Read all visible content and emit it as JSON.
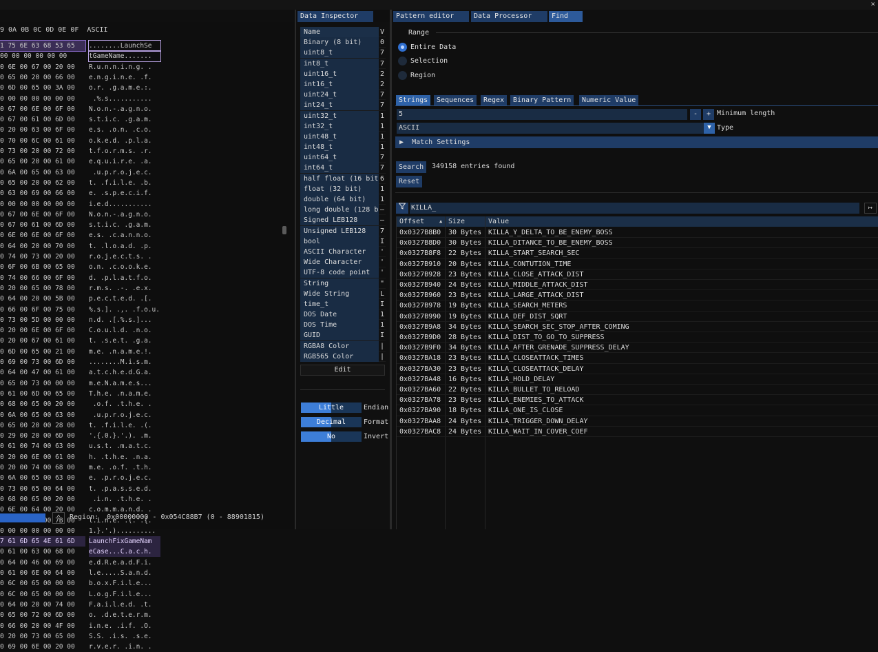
{
  "close_label": "×",
  "tabs": {
    "data_inspector": "Data Inspector",
    "pattern_editor": "Pattern editor",
    "data_processor": "Data Processor",
    "find": "Find"
  },
  "hex": {
    "header": "9 0A 0B 0C 0D 0E 0F  ASCII",
    "rows": [
      {
        "hex": "1 75 6E 63 68 53 65",
        "ascii": "........LaunchSe",
        "hex_sel": true,
        "ascii_box": true
      },
      {
        "hex": "00 00 00 00 00 00",
        "ascii": "tGameName.......",
        "ascii_box": true
      },
      {
        "hex": "0 6E 00 67 00 20 00",
        "ascii": "R.u.n.n.i.n.g. ."
      },
      {
        "hex": "0 65 00 20 00 66 00",
        "ascii": "e.n.g.i.n.e. .f."
      },
      {
        "hex": "0 6D 00 65 00 3A 00",
        "ascii": "o.r. .g.a.m.e.:."
      },
      {
        "hex": "0 00 00 00 00 00 00",
        "ascii": " .%.s..........."
      },
      {
        "hex": "0 67 00 6E 00 6F 00",
        "ascii": "N.o.n.-.a.g.n.o."
      },
      {
        "hex": "0 67 00 61 00 6D 00",
        "ascii": "s.t.i.c. .g.a.m."
      },
      {
        "hex": "0 20 00 63 00 6F 00",
        "ascii": "e.s. .o.n. .c.o."
      },
      {
        "hex": "0 70 00 6C 00 61 00",
        "ascii": "o.k.e.d. .p.l.a."
      },
      {
        "hex": "0 73 00 20 00 72 00",
        "ascii": "t.f.o.r.m.s. .r."
      },
      {
        "hex": "0 65 00 20 00 61 00",
        "ascii": "e.q.u.i.r.e. .a."
      },
      {
        "hex": "0 6A 00 65 00 63 00",
        "ascii": " .u.p.r.o.j.e.c."
      },
      {
        "hex": "0 65 00 20 00 62 00",
        "ascii": "t. .f.i.l.e. .b."
      },
      {
        "hex": "0 63 00 69 00 66 00",
        "ascii": "e. .s.p.e.c.i.f."
      },
      {
        "hex": "0 00 00 00 00 00 00",
        "ascii": "i.e.d..........."
      },
      {
        "hex": "0 67 00 6E 00 6F 00",
        "ascii": "N.o.n.-.a.g.n.o."
      },
      {
        "hex": "0 67 00 61 00 6D 00",
        "ascii": "s.t.i.c. .g.a.m."
      },
      {
        "hex": "0 6E 00 6E 00 6F 00",
        "ascii": "e.s. .c.a.n.n.o."
      },
      {
        "hex": "0 64 00 20 00 70 00",
        "ascii": "t. .l.o.a.d. .p."
      },
      {
        "hex": "0 74 00 73 00 20 00",
        "ascii": "r.o.j.e.c.t.s. ."
      },
      {
        "hex": "0 6F 00 6B 00 65 00",
        "ascii": "o.n. .c.o.o.k.e."
      },
      {
        "hex": "0 74 00 66 00 6F 00",
        "ascii": "d. .p.l.a.t.f.o."
      },
      {
        "hex": "0 20 00 65 00 78 00",
        "ascii": "r.m.s. .-. .e.x."
      },
      {
        "hex": "0 64 00 20 00 5B 00",
        "ascii": "p.e.c.t.e.d. .[."
      },
      {
        "hex": "0 66 00 6F 00 75 00",
        "ascii": "%.s.]. .,. .f.o.u."
      },
      {
        "hex": "0 73 00 5D 00 00 00",
        "ascii": "n.d. .[.%.s.]..."
      },
      {
        "hex": "0 20 00 6E 00 6F 00",
        "ascii": "C.o.u.l.d. .n.o."
      },
      {
        "hex": "0 20 00 67 00 61 00",
        "ascii": "t. .s.e.t. .g.a."
      },
      {
        "hex": "0 6D 00 65 00 21 00",
        "ascii": "m.e. .n.a.m.e.!."
      },
      {
        "hex": "0 69 00 73 00 6D 00",
        "ascii": "........M.i.s.m."
      },
      {
        "hex": "0 64 00 47 00 61 00",
        "ascii": "a.t.c.h.e.d.G.a."
      },
      {
        "hex": "0 65 00 73 00 00 00",
        "ascii": "m.e.N.a.m.e.s..."
      },
      {
        "hex": "0 61 00 6D 00 65 00",
        "ascii": "T.h.e. .n.a.m.e."
      },
      {
        "hex": "0 68 00 65 00 20 00",
        "ascii": " .o.f. .t.h.e. ."
      },
      {
        "hex": "0 6A 00 65 00 63 00",
        "ascii": " .u.p.r.o.j.e.c."
      },
      {
        "hex": "0 65 00 20 00 28 00",
        "ascii": "t. .f.i.l.e. .(."
      },
      {
        "hex": "0 29 00 20 00 6D 00",
        "ascii": "'.{.0.}.'.). .m."
      },
      {
        "hex": "0 61 00 74 00 63 00",
        "ascii": "u.s.t. .m.a.t.c."
      },
      {
        "hex": "0 20 00 6E 00 61 00",
        "ascii": "h. .t.h.e. .n.a."
      },
      {
        "hex": "0 20 00 74 00 68 00",
        "ascii": "m.e. .o.f. .t.h."
      },
      {
        "hex": "0 6A 00 65 00 63 00",
        "ascii": "e. .p.r.o.j.e.c."
      },
      {
        "hex": "0 73 00 65 00 64 00",
        "ascii": "t. .p.a.s.s.e.d."
      },
      {
        "hex": "0 68 00 65 00 20 00",
        "ascii": " .i.n. .t.h.e. ."
      },
      {
        "hex": "0 6E 00 64 00 20 00",
        "ascii": "c.o.m.m.a.n.d. ."
      },
      {
        "hex": "0 28 00 27 00 7B 00",
        "ascii": "l.i.n.e. .(.'.{."
      },
      {
        "hex": "0 00 00 00 00 00 00",
        "ascii": "1.}.'.).........."
      },
      {
        "hex": "7 61 6D 65 4E 61 6D",
        "ascii": "LaunchFixGameNam",
        "purple": true
      },
      {
        "hex": "0 61 00 63 00 68 00",
        "ascii": "eCase...C.a.c.h.",
        "ascii_purple": true
      },
      {
        "hex": "0 64 00 46 00 69 00",
        "ascii": "e.d.R.e.a.d.F.i."
      },
      {
        "hex": "0 61 00 6E 00 64 00",
        "ascii": "l.e.....S.a.n.d."
      },
      {
        "hex": "0 6C 00 65 00 00 00",
        "ascii": "b.o.x.F.i.l.e..."
      },
      {
        "hex": "0 6C 00 65 00 00 00",
        "ascii": "L.o.g.F.i.l.e..."
      },
      {
        "hex": "0 64 00 20 00 74 00",
        "ascii": "F.a.i.l.e.d. .t."
      },
      {
        "hex": "0 65 00 72 00 6D 00",
        "ascii": "o. .d.e.t.e.r.m."
      },
      {
        "hex": "0 66 00 20 00 4F 00",
        "ascii": "i.n.e. .i.f. .O."
      },
      {
        "hex": "0 20 00 73 00 65 00",
        "ascii": "S.S. .i.s. .s.e."
      },
      {
        "hex": "0 69 00 6E 00 20 00",
        "ascii": "r.v.e.r. .i.n. ."
      }
    ],
    "region_label": "Region:  0x00000000 - 0x054C88B7 (0 - 88901815)",
    "up_icon": "⌃"
  },
  "inspector": {
    "col_name": "Name",
    "col_value": "V",
    "rows": [
      {
        "name": "Binary (8 bit)",
        "value": "0"
      },
      {
        "name": "uint8_t",
        "value": "7"
      },
      {
        "name": "int8_t",
        "value": "7"
      },
      {
        "name": "uint16_t",
        "value": "2"
      },
      {
        "name": "int16_t",
        "value": "2"
      },
      {
        "name": "uint24_t",
        "value": "7"
      },
      {
        "name": "int24_t",
        "value": "7"
      },
      {
        "name": "uint32_t",
        "value": "1"
      },
      {
        "name": "int32_t",
        "value": "1"
      },
      {
        "name": "uint48_t",
        "value": "1"
      },
      {
        "name": "int48_t",
        "value": "1"
      },
      {
        "name": "uint64_t",
        "value": "7"
      },
      {
        "name": "int64_t",
        "value": "7"
      },
      {
        "name": "half float (16 bit)",
        "value": "6"
      },
      {
        "name": "float (32 bit)",
        "value": "1"
      },
      {
        "name": "double (64 bit)",
        "value": "1"
      },
      {
        "name": "long double (128 bit)",
        "value": "–"
      },
      {
        "name": "Signed LEB128",
        "value": "–"
      },
      {
        "name": "Unsigned LEB128",
        "value": "7"
      },
      {
        "name": "bool",
        "value": "I"
      },
      {
        "name": "ASCII Character",
        "value": "'"
      },
      {
        "name": "Wide Character",
        "value": "'"
      },
      {
        "name": "UTF-8 code point",
        "value": "'"
      },
      {
        "name": "String",
        "value": "\""
      },
      {
        "name": "Wide String",
        "value": "L"
      },
      {
        "name": "time_t",
        "value": "I"
      },
      {
        "name": "DOS Date",
        "value": "1"
      },
      {
        "name": "DOS Time",
        "value": "1"
      },
      {
        "name": "GUID",
        "value": "I"
      },
      {
        "name": "RGBA8 Color",
        "value": "|"
      },
      {
        "name": "RGB565 Color",
        "value": "|"
      }
    ],
    "edit_label": "Edit",
    "options": [
      {
        "value": "Little",
        "label": "Endian",
        "fill": 0.5
      },
      {
        "value": "Decimal",
        "label": "Format",
        "fill": 0.5
      },
      {
        "value": "No",
        "label": "Invert",
        "fill": 0.5
      }
    ]
  },
  "find": {
    "range_label": "Range",
    "range_options": [
      "Entire Data",
      "Selection",
      "Region"
    ],
    "range_selected": 0,
    "subtabs": [
      "Strings",
      "Sequences",
      "Regex",
      "Binary Pattern",
      "Numeric Value"
    ],
    "subtab_selected": 0,
    "min_length_value": "5",
    "minus": "-",
    "plus": "+",
    "min_length_label": "Minimum length",
    "type_value": "ASCII",
    "type_label": "Type",
    "match_settings_label": "Match Settings",
    "search_label": "Search",
    "entries_found": "349158 entries found",
    "reset_label": "Reset",
    "filter_icon": "filter-icon",
    "filter_value": "KILLA_",
    "filter_end_icon": "↦",
    "columns": {
      "offset": "Offset",
      "sort": "▲",
      "size": "Size",
      "value": "Value"
    },
    "results": [
      {
        "offset": "0x0327B8B0",
        "size": "30 Bytes",
        "value": "KILLA_Y_DELTA_TO_BE_ENEMY_BOSS"
      },
      {
        "offset": "0x0327B8D0",
        "size": "30 Bytes",
        "value": "KILLA_DITANCE_TO_BE_ENEMY_BOSS"
      },
      {
        "offset": "0x0327B8F8",
        "size": "22 Bytes",
        "value": "KILLA_START_SEARCH_SEC"
      },
      {
        "offset": "0x0327B910",
        "size": "20 Bytes",
        "value": "KILLA_CONTUTION_TIME"
      },
      {
        "offset": "0x0327B928",
        "size": "23 Bytes",
        "value": "KILLA_CLOSE_ATTACK_DIST"
      },
      {
        "offset": "0x0327B940",
        "size": "24 Bytes",
        "value": "KILLA_MIDDLE_ATTACK_DIST"
      },
      {
        "offset": "0x0327B960",
        "size": "23 Bytes",
        "value": "KILLA_LARGE_ATTACK_DIST"
      },
      {
        "offset": "0x0327B978",
        "size": "19 Bytes",
        "value": "KILLA_SEARCH_METERS"
      },
      {
        "offset": "0x0327B990",
        "size": "19 Bytes",
        "value": "KILLA_DEF_DIST_SQRT"
      },
      {
        "offset": "0x0327B9A8",
        "size": "34 Bytes",
        "value": "KILLA_SEARCH_SEC_STOP_AFTER_COMING"
      },
      {
        "offset": "0x0327B9D0",
        "size": "28 Bytes",
        "value": "KILLA_DIST_TO_GO_TO_SUPPRESS"
      },
      {
        "offset": "0x0327B9F0",
        "size": "34 Bytes",
        "value": "KILLA_AFTER_GRENADE_SUPPRESS_DELAY"
      },
      {
        "offset": "0x0327BA18",
        "size": "23 Bytes",
        "value": "KILLA_CLOSEATTACK_TIMES"
      },
      {
        "offset": "0x0327BA30",
        "size": "23 Bytes",
        "value": "KILLA_CLOSEATTACK_DELAY"
      },
      {
        "offset": "0x0327BA48",
        "size": "16 Bytes",
        "value": "KILLA_HOLD_DELAY"
      },
      {
        "offset": "0x0327BA60",
        "size": "22 Bytes",
        "value": "KILLA_BULLET_TO_RELOAD"
      },
      {
        "offset": "0x0327BA78",
        "size": "23 Bytes",
        "value": "KILLA_ENEMIES_TO_ATTACK"
      },
      {
        "offset": "0x0327BA90",
        "size": "18 Bytes",
        "value": "KILLA_ONE_IS_CLOSE"
      },
      {
        "offset": "0x0327BAA8",
        "size": "24 Bytes",
        "value": "KILLA_TRIGGER_DOWN_DELAY"
      },
      {
        "offset": "0x0327BAC8",
        "size": "24 Bytes",
        "value": "KILLA_WAIT_IN_COVER_COEF"
      }
    ]
  },
  "colors": {
    "accent": "#2f6fd0",
    "tab": "#1f3c66",
    "input": "#192c44",
    "selection": "#3a2d55"
  }
}
